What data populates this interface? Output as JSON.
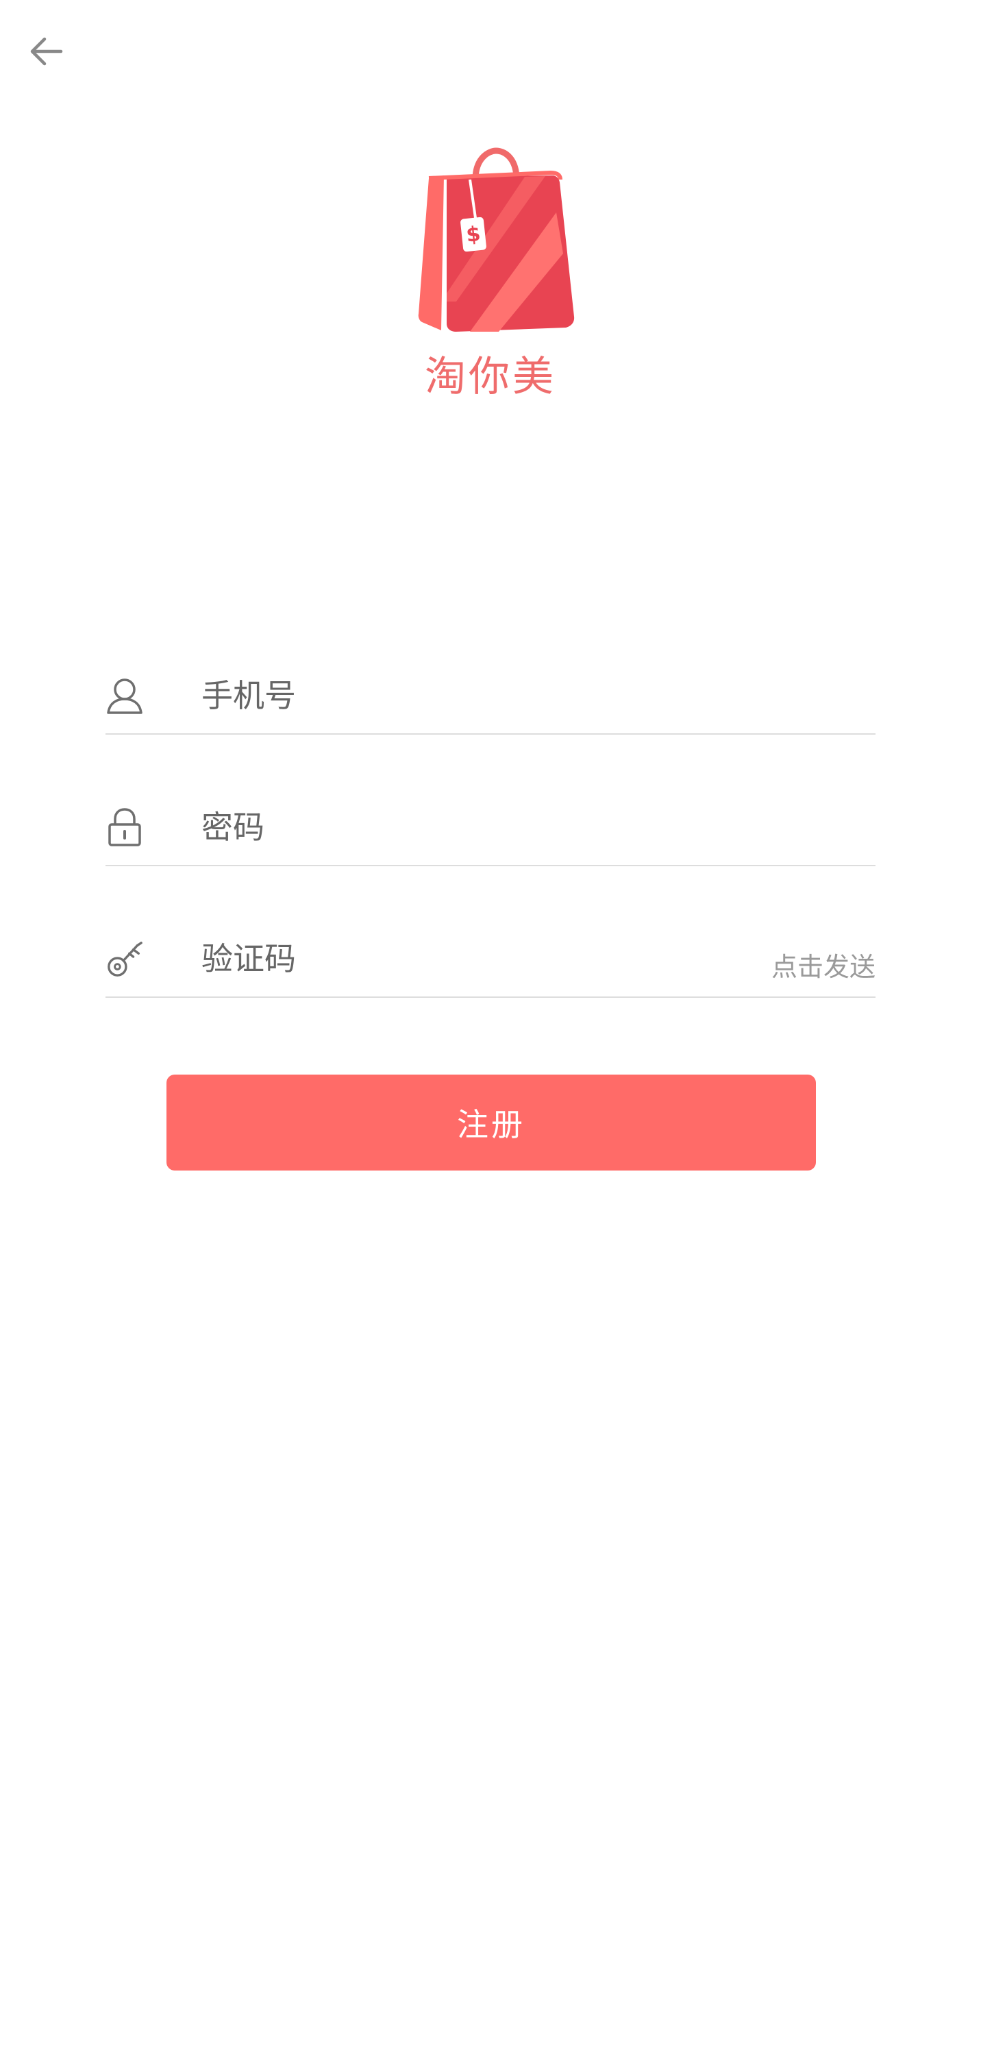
{
  "header": {
    "back_icon": "arrow-left-icon"
  },
  "brand": {
    "logo_icon": "shopping-bag-icon",
    "app_name": "淘你美",
    "accent_color": "#ff6b68",
    "name_color": "#ef6c6c"
  },
  "form": {
    "phone": {
      "icon": "user-icon",
      "placeholder": "手机号",
      "value": ""
    },
    "password": {
      "icon": "lock-icon",
      "placeholder": "密码",
      "value": ""
    },
    "code": {
      "icon": "key-icon",
      "placeholder": "验证码",
      "value": "",
      "send_label": "点击发送"
    }
  },
  "actions": {
    "register_label": "注册"
  }
}
